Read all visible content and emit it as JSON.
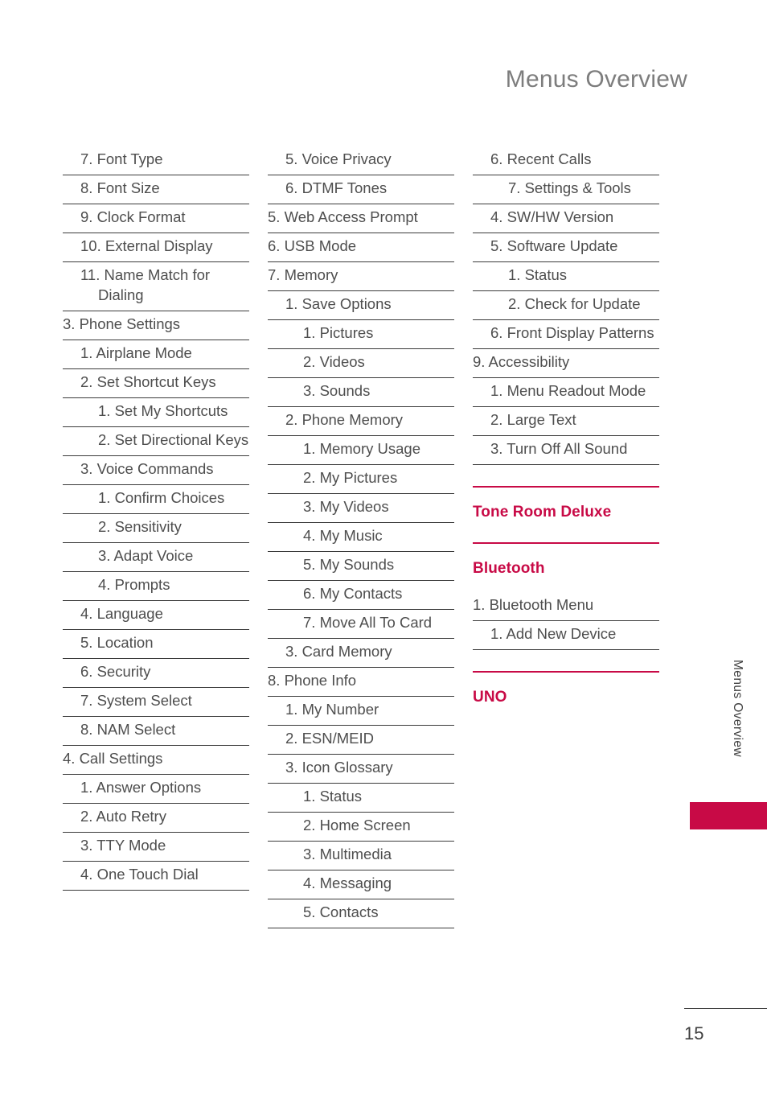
{
  "header": {
    "title": "Menus Overview"
  },
  "side_tab": {
    "label": "Menus Overview"
  },
  "footer": {
    "page_number": "15"
  },
  "colors": {
    "accent": "#c80a46",
    "title_gray": "#7d7d7d",
    "body_text": "#4e4e4e",
    "rule": "#3b3b3b"
  },
  "columns": [
    {
      "name": "column-1",
      "items": [
        {
          "label": "7. Font Type",
          "level": 2
        },
        {
          "label": "8. Font Size",
          "level": 2
        },
        {
          "label": "9. Clock Format",
          "level": 2
        },
        {
          "label": "10. External Display",
          "level": 2
        },
        {
          "label": "11. Name Match for Dialing",
          "level": 2
        },
        {
          "label": "3. Phone Settings",
          "level": 1
        },
        {
          "label": "1. Airplane Mode",
          "level": 2
        },
        {
          "label": "2. Set Shortcut Keys",
          "level": 2
        },
        {
          "label": "1. Set My Shortcuts",
          "level": 3
        },
        {
          "label": "2. Set Directional Keys",
          "level": 3
        },
        {
          "label": "3. Voice Commands",
          "level": 2
        },
        {
          "label": "1. Confirm Choices",
          "level": 3
        },
        {
          "label": "2. Sensitivity",
          "level": 3
        },
        {
          "label": "3. Adapt Voice",
          "level": 3
        },
        {
          "label": "4. Prompts",
          "level": 3
        },
        {
          "label": "4. Language",
          "level": 2
        },
        {
          "label": "5. Location",
          "level": 2
        },
        {
          "label": "6. Security",
          "level": 2
        },
        {
          "label": "7. System Select",
          "level": 2
        },
        {
          "label": "8. NAM Select",
          "level": 2
        },
        {
          "label": "4. Call Settings",
          "level": 1
        },
        {
          "label": "1. Answer Options",
          "level": 2
        },
        {
          "label": "2. Auto Retry",
          "level": 2
        },
        {
          "label": "3. TTY Mode",
          "level": 2
        },
        {
          "label": "4. One Touch Dial",
          "level": 2
        }
      ],
      "sections": []
    },
    {
      "name": "column-2",
      "items": [
        {
          "label": "5. Voice Privacy",
          "level": 2
        },
        {
          "label": "6. DTMF Tones",
          "level": 2
        },
        {
          "label": "5. Web Access Prompt",
          "level": 1
        },
        {
          "label": "6. USB Mode",
          "level": 1
        },
        {
          "label": "7. Memory",
          "level": 1
        },
        {
          "label": "1. Save Options",
          "level": 2
        },
        {
          "label": "1. Pictures",
          "level": 3
        },
        {
          "label": "2. Videos",
          "level": 3
        },
        {
          "label": "3. Sounds",
          "level": 3
        },
        {
          "label": "2. Phone Memory",
          "level": 2
        },
        {
          "label": "1. Memory Usage",
          "level": 3
        },
        {
          "label": "2. My Pictures",
          "level": 3
        },
        {
          "label": "3. My Videos",
          "level": 3
        },
        {
          "label": "4. My Music",
          "level": 3
        },
        {
          "label": "5. My Sounds",
          "level": 3
        },
        {
          "label": "6. My Contacts",
          "level": 3
        },
        {
          "label": "7. Move All To Card",
          "level": 3
        },
        {
          "label": "3. Card Memory",
          "level": 2
        },
        {
          "label": "8. Phone Info",
          "level": 1
        },
        {
          "label": "1. My Number",
          "level": 2
        },
        {
          "label": "2. ESN/MEID",
          "level": 2
        },
        {
          "label": "3. Icon Glossary",
          "level": 2
        },
        {
          "label": "1. Status",
          "level": 3
        },
        {
          "label": "2. Home Screen",
          "level": 3
        },
        {
          "label": "3. Multimedia",
          "level": 3
        },
        {
          "label": "4. Messaging",
          "level": 3
        },
        {
          "label": "5. Contacts",
          "level": 3
        }
      ],
      "sections": []
    },
    {
      "name": "column-3",
      "items": [
        {
          "label": "6. Recent Calls",
          "level": 2
        },
        {
          "label": "7. Settings & Tools",
          "level": 3
        },
        {
          "label": "4. SW/HW Version",
          "level": 2
        },
        {
          "label": "5. Software Update",
          "level": 2
        },
        {
          "label": "1. Status",
          "level": 3
        },
        {
          "label": "2. Check for Update",
          "level": 3
        },
        {
          "label": "6. Front Display Patterns",
          "level": 2
        },
        {
          "label": "9. Accessibility",
          "level": 1
        },
        {
          "label": "1. Menu Readout Mode",
          "level": 2
        },
        {
          "label": "2. Large Text",
          "level": 2
        },
        {
          "label": "3. Turn Off All Sound",
          "level": 2
        }
      ],
      "sections": [
        {
          "title": "Tone Room Deluxe",
          "items": []
        },
        {
          "title": "Bluetooth",
          "items": [
            {
              "label": "1. Bluetooth Menu",
              "level": 1
            },
            {
              "label": "1. Add New Device",
              "level": 2
            }
          ]
        },
        {
          "title": "UNO",
          "items": []
        }
      ]
    }
  ]
}
